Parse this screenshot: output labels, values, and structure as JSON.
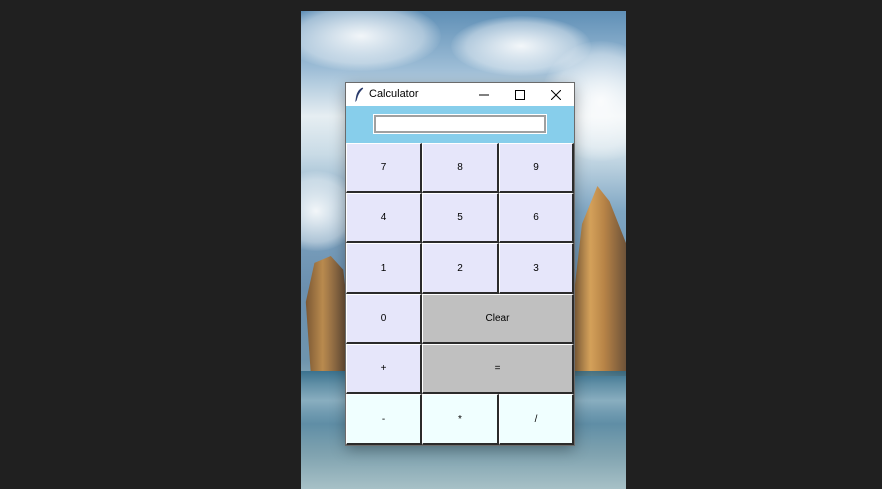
{
  "window": {
    "title": "Calculator"
  },
  "display": {
    "value": ""
  },
  "keys": {
    "row1": [
      "7",
      "8",
      "9"
    ],
    "row2": [
      "4",
      "5",
      "6"
    ],
    "row3": [
      "1",
      "2",
      "3"
    ],
    "row4": [
      "0",
      "Clear"
    ],
    "row5": [
      "+",
      "="
    ],
    "row6": [
      "-",
      "*",
      "/"
    ]
  },
  "colors": {
    "display_bg": "#87ceeb",
    "number_key": "#e6e6fa",
    "function_key": "#c0c0c0",
    "operator_key": "#f0ffff"
  },
  "icons": {
    "app": "feather-icon",
    "minimize": "minimize-icon",
    "maximize": "maximize-icon",
    "close": "close-icon"
  }
}
